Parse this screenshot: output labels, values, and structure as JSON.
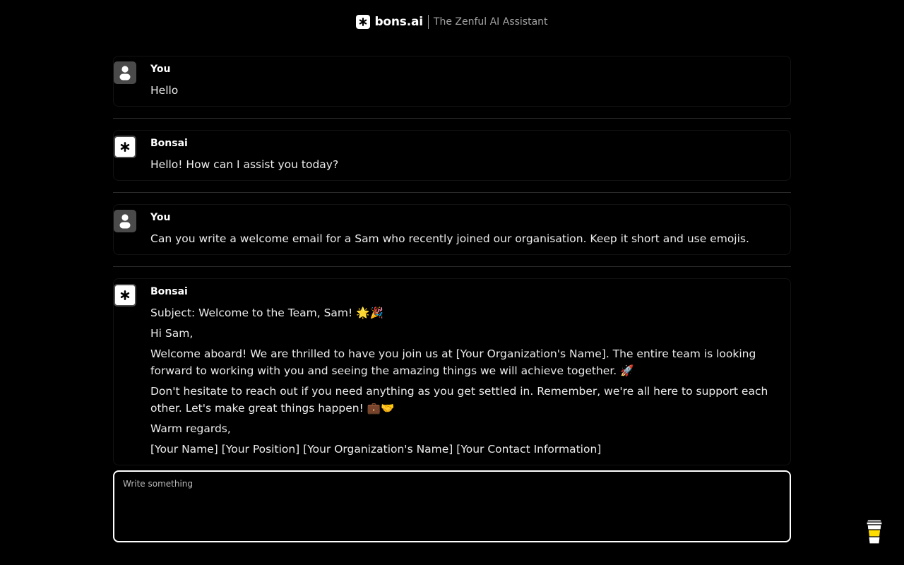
{
  "header": {
    "brand": "bons.ai",
    "tagline": "The Zenful AI Assistant",
    "logo_icon": "asterisk-icon"
  },
  "messages": [
    {
      "role": "user",
      "author": "You",
      "avatar_icon": "user-icon",
      "paragraphs": [
        "Hello"
      ]
    },
    {
      "role": "bot",
      "author": "Bonsai",
      "avatar_icon": "asterisk-icon",
      "paragraphs": [
        "Hello! How can I assist you today?"
      ]
    },
    {
      "role": "user",
      "author": "You",
      "avatar_icon": "user-icon",
      "paragraphs": [
        "Can you write a welcome email for a Sam who recently joined our organisation. Keep it short and use emojis."
      ]
    },
    {
      "role": "bot",
      "author": "Bonsai",
      "avatar_icon": "asterisk-icon",
      "paragraphs": [
        "Subject: Welcome to the Team, Sam! 🌟🎉",
        "Hi Sam,",
        "Welcome aboard! We are thrilled to have you join us at [Your Organization's Name]. The entire team is looking forward to working with you and seeing the amazing things we will achieve together. 🚀",
        "Don't hesitate to reach out if you need anything as you get settled in. Remember, we're all here to support each other. Let's make great things happen! 💼🤝",
        "Warm regards,",
        "[Your Name] [Your Position] [Your Organization's Name] [Your Contact Information]"
      ]
    }
  ],
  "composer": {
    "placeholder": "Write something"
  },
  "widgets": {
    "coffee_icon": "coffee-cup-icon"
  }
}
